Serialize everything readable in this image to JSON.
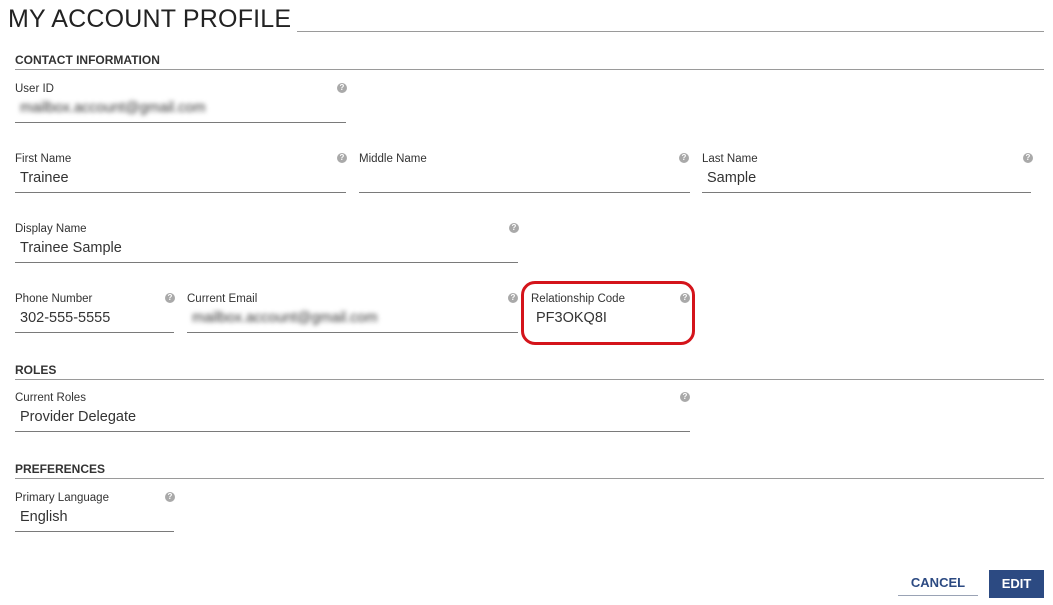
{
  "page": {
    "title": "MY ACCOUNT PROFILE"
  },
  "sections": {
    "contact": "CONTACT INFORMATION",
    "roles": "ROLES",
    "preferences": "PREFERENCES"
  },
  "fields": {
    "user_id": {
      "label": "User ID",
      "value": "mailbox.account@gmail.com"
    },
    "first_name": {
      "label": "First Name",
      "value": "Trainee"
    },
    "middle_name": {
      "label": "Middle Name",
      "value": ""
    },
    "last_name": {
      "label": "Last Name",
      "value": "Sample"
    },
    "display_name": {
      "label": "Display Name",
      "value": "Trainee Sample"
    },
    "phone_number": {
      "label": "Phone Number",
      "value": "302-555-5555"
    },
    "current_email": {
      "label": "Current Email",
      "value": "mailbox.account@gmail.com"
    },
    "relationship_code": {
      "label": "Relationship Code",
      "value": "PF3OKQ8I"
    },
    "current_roles": {
      "label": "Current Roles",
      "value": "Provider Delegate"
    },
    "primary_language": {
      "label": "Primary Language",
      "value": "English"
    }
  },
  "buttons": {
    "cancel": "CANCEL",
    "edit": "EDIT"
  },
  "colors": {
    "accent": "#2c4a82",
    "highlight": "#d4141b",
    "help_icon": "#a9a9a9"
  },
  "icons": {
    "help": "help-icon"
  }
}
